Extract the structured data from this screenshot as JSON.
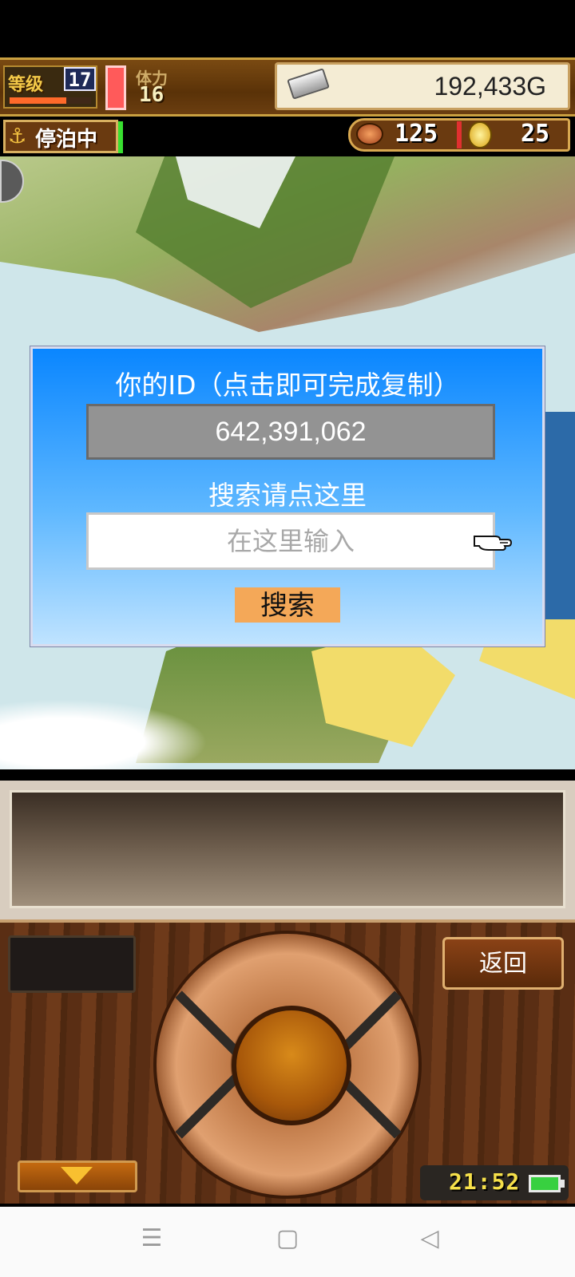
{
  "hud": {
    "level_label": "等级",
    "level_value": "17",
    "level_progress": 0.7,
    "stamina_label": "体力",
    "stamina_value": "16",
    "gold_value": "192,433G",
    "dock_label": "停泊中",
    "food_value": "125",
    "coin_value": "25"
  },
  "dialog": {
    "title": "你的ID（点击即可完成复制）",
    "id_value": "642,391,062",
    "search_hint": "搜索请点这里",
    "search_placeholder": "在这里输入",
    "search_button": "搜索"
  },
  "controls": {
    "back_button": "返回",
    "clock": "21:52"
  },
  "colors": {
    "dialog_top": "#0a86ff",
    "dialog_bottom": "#bfe3ff",
    "search_button": "#f4a858",
    "id_box": "#939393"
  },
  "icons": {
    "silver": "silver-ingot-icon",
    "anchor": "anchor-icon",
    "food": "meat-icon",
    "coin": "coin-icon",
    "pointer": "pointing-hand-icon",
    "battery": "battery-icon"
  },
  "navbar": {
    "menu_icon": "☰",
    "home_icon": "▢",
    "back_icon": "◁"
  }
}
